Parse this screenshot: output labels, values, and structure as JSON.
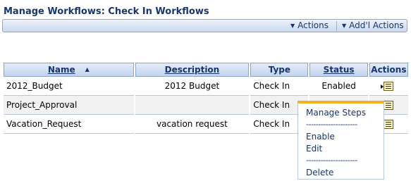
{
  "page": {
    "title": "Manage Workflows: Check In Workflows"
  },
  "toolbar": {
    "actions_label": "Actions",
    "addl_actions_label": "Add'l Actions"
  },
  "table": {
    "columns": [
      {
        "label": "Name",
        "sortable": true,
        "sorted": "ascending"
      },
      {
        "label": "Description",
        "sortable": true
      },
      {
        "label": "Type",
        "sortable": false
      },
      {
        "label": "Status",
        "sortable": true
      },
      {
        "label": "Actions",
        "sortable": false
      }
    ],
    "rows": [
      {
        "name": "2012_Budget",
        "description": "2012 Budget",
        "type": "Check In",
        "status": "Enabled",
        "action_icon": "actions-menu-icon"
      },
      {
        "name": "Project_Approval",
        "description": "",
        "type": "Check In",
        "status": "",
        "action_icon": "actions-menu-icon"
      },
      {
        "name": "Vacation_Request",
        "description": "vacation request",
        "type": "Check In",
        "status": "",
        "action_icon": "actions-menu-icon"
      }
    ]
  },
  "context_menu": {
    "accent_color": "#f0b020",
    "items": [
      "Manage Steps",
      "Enable",
      "Edit",
      "Delete"
    ],
    "separator": "---------------------"
  }
}
